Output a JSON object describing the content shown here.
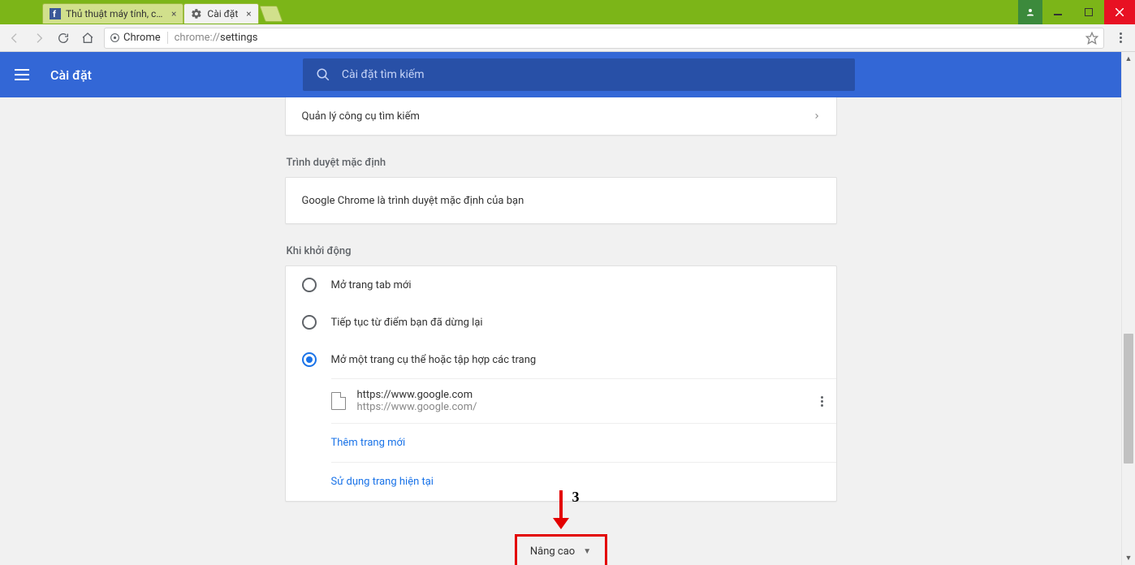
{
  "window": {
    "tabs": [
      {
        "title": "Thủ thuật máy tính, cài đ",
        "favicon": "fb"
      },
      {
        "title": "Cài đặt",
        "favicon": "gear"
      }
    ]
  },
  "toolbar": {
    "chip": "Chrome",
    "url_prefix": "chrome://",
    "url_bold": "settings"
  },
  "header": {
    "title": "Cài đặt",
    "search_placeholder": "Cài đặt tìm kiếm"
  },
  "rows": {
    "manage_search": "Quản lý công cụ tìm kiếm"
  },
  "sections": {
    "default_browser": "Trình duyệt mặc định",
    "default_browser_text": "Google Chrome là trình duyệt mặc định của bạn",
    "on_startup": "Khi khởi động"
  },
  "startup": {
    "opt1": "Mở trang tab mới",
    "opt2": "Tiếp tục từ điểm bạn đã dừng lại",
    "opt3": "Mở một trang cụ thể hoặc tập hợp các trang",
    "page_url_title": "https://www.google.com",
    "page_url_sub": "https://www.google.com/",
    "add_new": "Thêm trang mới",
    "use_current": "Sử dụng trang hiện tại"
  },
  "advanced": {
    "label": "Nâng cao"
  },
  "annotation": {
    "number": "3"
  }
}
